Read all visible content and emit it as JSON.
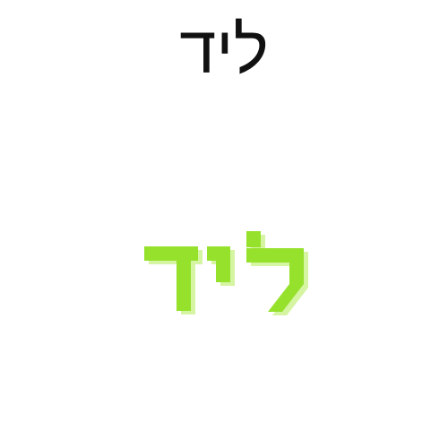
{
  "word": "ליד",
  "colors": {
    "background": "#ffffff",
    "text": "#111111",
    "accent": "#95e12c",
    "shadow": "#d5f5a2"
  }
}
